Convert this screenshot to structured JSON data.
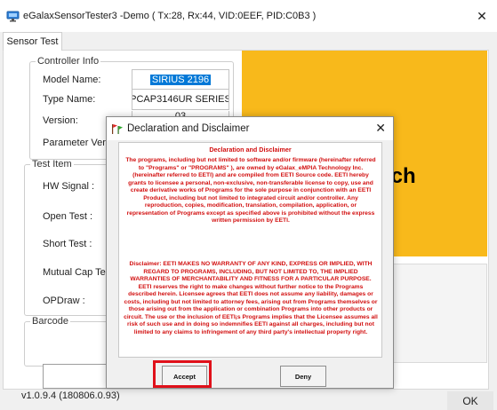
{
  "window": {
    "title": "eGalaxSensorTester3 -Demo ( Tx:28, Rx:44, VID:0EEF, PID:C0B3 )",
    "close_glyph": "✕",
    "icon": "app-monitor-icon"
  },
  "tab": {
    "label": "Sensor Test"
  },
  "controller_info": {
    "legend": "Controller Info",
    "model_label": "Model Name:",
    "model_value": "SIRIUS 2196",
    "type_label": "Type Name:",
    "type_value": "PCAP3146UR SERIES",
    "version_label": "Version:",
    "version_value": "03",
    "param_label": "Parameter Version:"
  },
  "test_item": {
    "legend": "Test Item",
    "hw_signal": "HW Signal :",
    "open_test": "Open Test :",
    "short_test": "Short Test :",
    "mutual_cap": "Mutual Cap Test :",
    "opdraw": "OPDraw :"
  },
  "barcode": {
    "legend": "Barcode",
    "value": ""
  },
  "yellow_panel": {
    "line1": "l.",
    "line2": "uch",
    "color": "#f8b91b"
  },
  "footer": {
    "version": "v1.0.9.4 (180806.0.93)",
    "ok_label": "OK"
  },
  "dialog": {
    "title": "Declaration and Disclaimer",
    "close_glyph": "✕",
    "icon": "warning-flags-icon",
    "heading": "Declaration and Disclaimer",
    "para1": "The programs, including but not limited to software and/or firmware (hereinafter referred to \"Programs\" or \"PROGRAMS\" ), are owned by eGalax_eMPIA Technology Inc. (hereinafter referred to EETI) and are compiled from EETI Source code. EETI hereby grants to licensee a personal, non-exclusive, non-transferable license to copy, use and create derivative works of Programs for the sole purpose in conjunction with an EETI Product, including but not limited to integrated circuit and/or controller. Any reproduction, copies, modification, translation, compilation, application, or representation of Programs except as specified above is prohibited without the express written permission by EETI.",
    "para2": "Disclaimer: EETI MAKES NO WARRANTY OF ANY KIND, EXPRESS OR IMPLIED, WITH REGARD TO PROGRAMS, INCLUDING, BUT NOT LIMITED TO, THE IMPLIED WARRANTIES OF MERCHANTABILITY AND FITNESS FOR A PARTICULAR PURPOSE. EETI reserves the right to make changes without further notice to the Programs described herein. Licensee agrees that EETI does not assume any liability, damages or costs, including but not limited to attorney fees, arising out from Programs themselves or those arising out from the application or combination Programs into other products or circuit. The use or the inclusion of EETI¡s Programs implies that the Licensee assumes all risk of such use and in doing so indemnifies EETI against all charges, including but not limited to any claims to infringement of any third party's intellectual property right.",
    "accept_label": "Accept",
    "deny_label": "Deny",
    "highlight_color": "#e0101a"
  }
}
